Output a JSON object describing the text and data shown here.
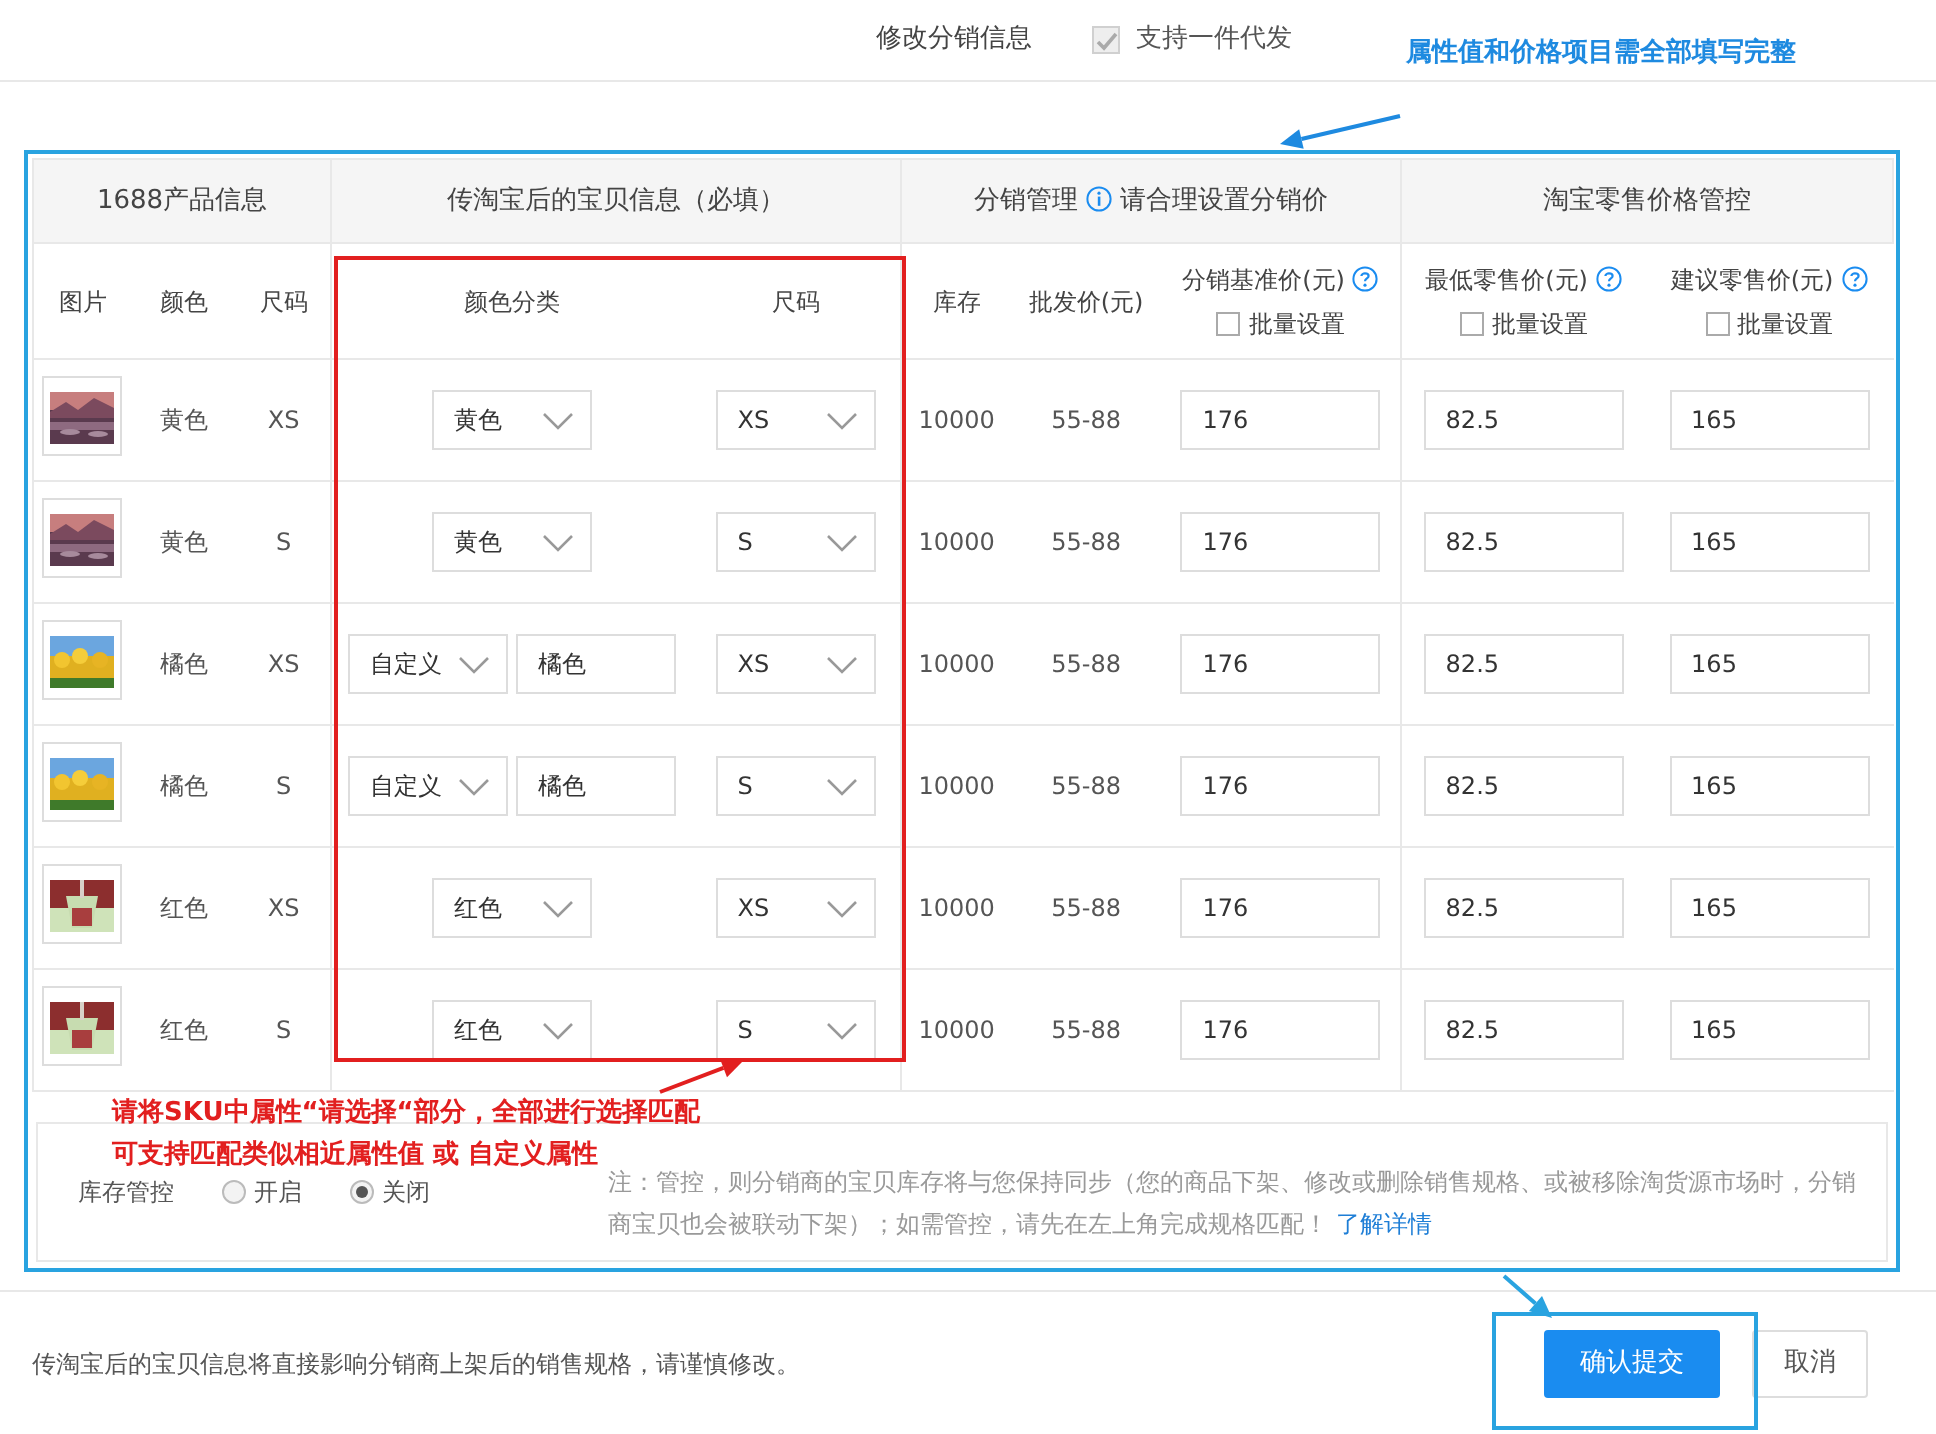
{
  "header": {
    "title": "修改分销信息",
    "one_piece": {
      "label": "支持一件代发",
      "checked": true,
      "disabled": true
    }
  },
  "callout_top": "属性值和价格项目需全部填写完整",
  "callout_sku": [
    "请将SKU中属性“请选择“部分，全部进行选择匹配",
    "可支持匹配类似相近属性值 或 自定义属性"
  ],
  "table": {
    "groups": [
      {
        "label": "1688产品信息",
        "info": false
      },
      {
        "label": "传淘宝后的宝贝信息（必填）",
        "info": false
      },
      {
        "label": "分销管理",
        "info": true,
        "hint": "请合理设置分销价"
      },
      {
        "label": "淘宝零售价格管控",
        "info": false
      }
    ],
    "columns": [
      {
        "label": "图片",
        "help": false
      },
      {
        "label": "颜色",
        "help": false
      },
      {
        "label": "尺码",
        "help": false
      },
      {
        "label": "颜色分类",
        "help": false
      },
      {
        "label": "尺码",
        "help": false
      },
      {
        "label": "库存",
        "help": false
      },
      {
        "label": "批发价(元)",
        "help": false
      },
      {
        "label": "分销基准价(元)",
        "help": true,
        "batch": {
          "label": "批量设置",
          "checked": false
        }
      },
      {
        "label": "最低零售价(元)",
        "help": true,
        "batch": {
          "label": "批量设置",
          "checked": false
        }
      },
      {
        "label": "建议零售价(元)",
        "help": true,
        "batch": {
          "label": "批量设置",
          "checked": false
        }
      }
    ],
    "rows": [
      {
        "color_name": "黄色",
        "size_name": "XS",
        "color_class": {
          "kind": "select",
          "value": "黄色"
        },
        "size_select": "XS",
        "stock": "10000",
        "wholesale": "55-88",
        "base_price": "176",
        "min_price": "82.5",
        "suggested_price": "165"
      },
      {
        "color_name": "黄色",
        "size_name": "S",
        "color_class": {
          "kind": "select",
          "value": "黄色"
        },
        "size_select": "S",
        "stock": "10000",
        "wholesale": "55-88",
        "base_price": "176",
        "min_price": "82.5",
        "suggested_price": "165"
      },
      {
        "color_name": "橘色",
        "size_name": "XS",
        "color_class": {
          "kind": "custom",
          "value": "自定义",
          "custom_value": "橘色"
        },
        "size_select": "XS",
        "stock": "10000",
        "wholesale": "55-88",
        "base_price": "176",
        "min_price": "82.5",
        "suggested_price": "165"
      },
      {
        "color_name": "橘色",
        "size_name": "S",
        "color_class": {
          "kind": "custom",
          "value": "自定义",
          "custom_value": "橘色"
        },
        "size_select": "S",
        "stock": "10000",
        "wholesale": "55-88",
        "base_price": "176",
        "min_price": "82.5",
        "suggested_price": "165"
      },
      {
        "color_name": "红色",
        "size_name": "XS",
        "color_class": {
          "kind": "select",
          "value": "红色"
        },
        "size_select": "XS",
        "stock": "10000",
        "wholesale": "55-88",
        "base_price": "176",
        "min_price": "82.5",
        "suggested_price": "165"
      },
      {
        "color_name": "红色",
        "size_name": "S",
        "color_class": {
          "kind": "select",
          "value": "红色"
        },
        "size_select": "S",
        "stock": "10000",
        "wholesale": "55-88",
        "base_price": "176",
        "min_price": "82.5",
        "suggested_price": "165"
      }
    ]
  },
  "inventory": {
    "label": "库存管控",
    "options": [
      {
        "label": "开启",
        "selected": false
      },
      {
        "label": "关闭",
        "selected": true
      }
    ],
    "note": "注：管控，则分销商的宝贝库存将与您保持同步（您的商品下架、修改或删除销售规格、或被移除淘货源市场时，分销商宝贝也会被联动下架）；如需管控，请先在左上角完成规格匹配！",
    "link": "了解详情"
  },
  "footer": {
    "text": "传淘宝后的宝贝信息将直接影响分销商上架后的销售规格，请谨慎修改。",
    "buttons": [
      {
        "label": "确认提交",
        "kind": "primary"
      },
      {
        "label": "取消",
        "kind": "secondary"
      }
    ]
  }
}
